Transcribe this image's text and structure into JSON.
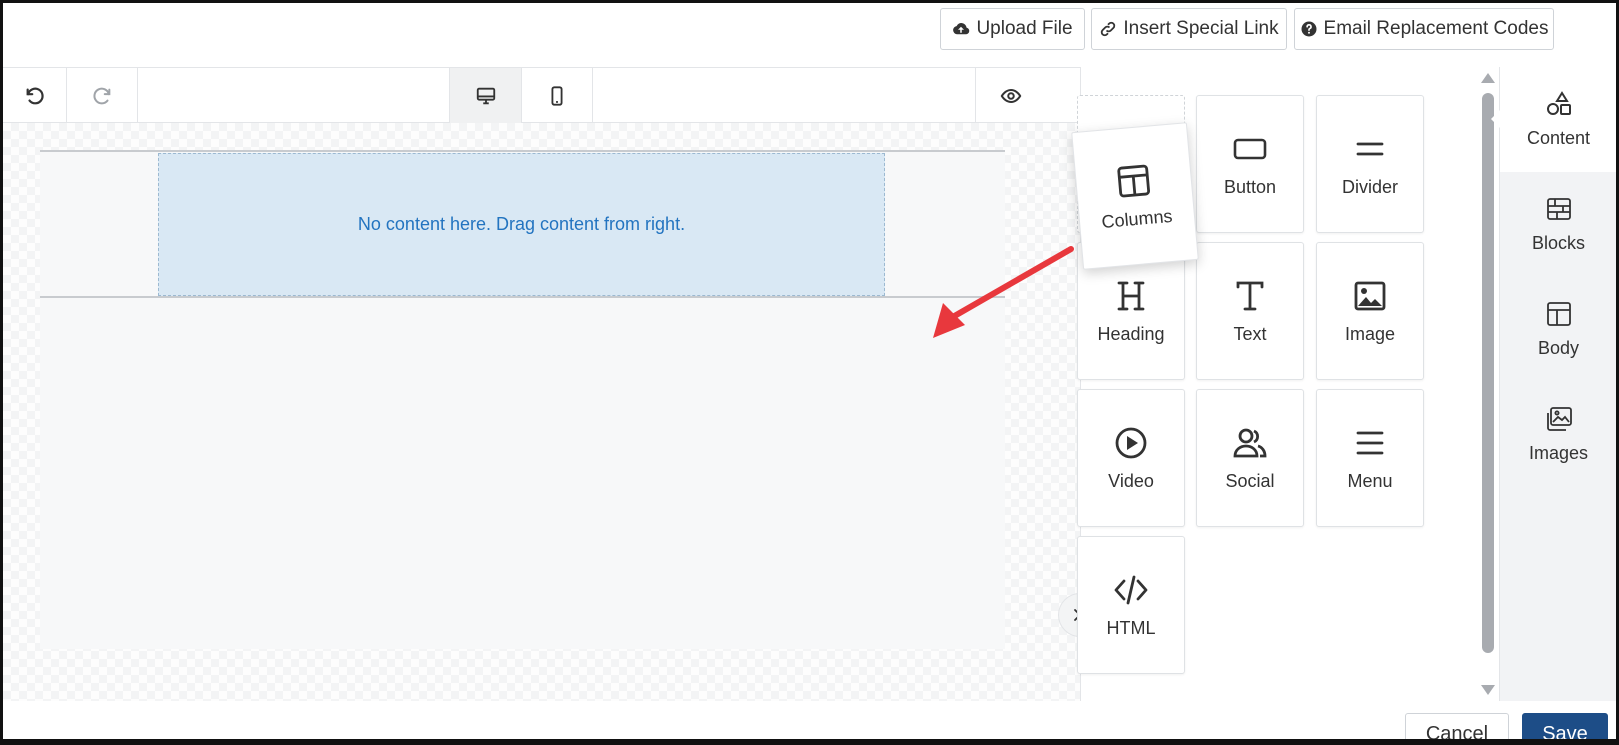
{
  "top_buttons": {
    "upload": "Upload File",
    "insert_link": "Insert Special Link",
    "email_codes": "Email Replacement Codes"
  },
  "canvas": {
    "dropzone_text": "No content here. Drag content from right."
  },
  "content_tiles": [
    {
      "label": "Button",
      "icon": "button-icon"
    },
    {
      "label": "Divider",
      "icon": "divider-icon"
    },
    {
      "label": "Heading",
      "icon": "heading-icon"
    },
    {
      "label": "Text",
      "icon": "text-icon"
    },
    {
      "label": "Image",
      "icon": "image-icon"
    },
    {
      "label": "Video",
      "icon": "video-icon"
    },
    {
      "label": "Social",
      "icon": "social-icon"
    },
    {
      "label": "Menu",
      "icon": "menu-icon"
    },
    {
      "label": "HTML",
      "icon": "html-icon"
    }
  ],
  "dragging_tile": {
    "label": "Columns",
    "icon": "columns-icon"
  },
  "tabs": [
    {
      "label": "Content",
      "icon": "shapes-icon",
      "active": true
    },
    {
      "label": "Blocks",
      "icon": "blocks-icon"
    },
    {
      "label": "Body",
      "icon": "body-layout-icon"
    },
    {
      "label": "Images",
      "icon": "images-icon"
    }
  ],
  "footer": {
    "cancel": "Cancel",
    "save": "Save"
  },
  "colors": {
    "accent_blue": "#2374c0",
    "save_blue": "#1d4d87",
    "arrow_red": "#e8383d",
    "dropzone_bg": "#d9e8f4"
  }
}
